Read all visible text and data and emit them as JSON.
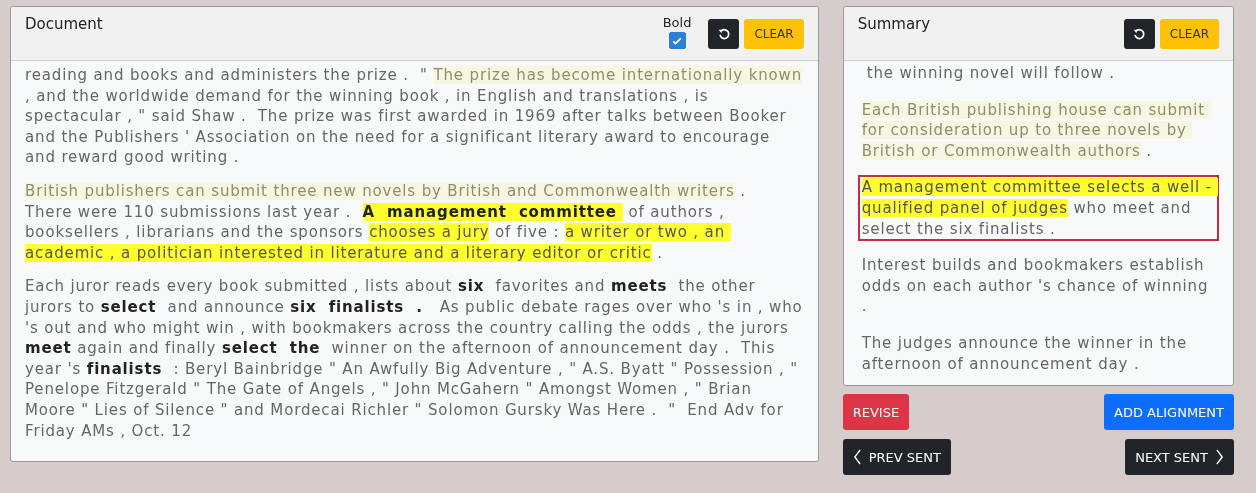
{
  "document": {
    "title": "Document",
    "bold_toggle": {
      "label": "Bold",
      "checked": true
    },
    "clear_label": "CLEAR",
    "paragraphs": [
      {
        "segments": [
          {
            "kind": "plain",
            "text": "reading and books and administers the prize .  \" "
          },
          {
            "kind": "faded",
            "text": "The prize has become internationally known"
          },
          {
            "kind": "plain",
            "text": " , and the worldwide demand for the winning book , in English and translations , is spectacular , \" said Shaw .  The prize was first awarded in 1969 after talks between Booker and the Publishers ' Association on the need for a significant literary award to encourage and reward good writing ."
          }
        ]
      },
      {
        "segments": [
          {
            "kind": "faded",
            "text": "British publishers can submit three new novels by British and Commonwealth writers"
          },
          {
            "kind": "plain",
            "text": " .  There were 110 submissions last year .  "
          },
          {
            "kind": "marked_bold",
            "text": "A  management  committee "
          },
          {
            "kind": "plain",
            "text": " of authors , booksellers , librarians and the sponsors "
          },
          {
            "kind": "marked",
            "text": "chooses a jury"
          },
          {
            "kind": "plain",
            "text": " of five : "
          },
          {
            "kind": "marked",
            "text": "a writer or two , an academic , a politician interested in literature and a literary editor or critic"
          },
          {
            "kind": "plain",
            "text": " ."
          }
        ]
      },
      {
        "segments": [
          {
            "kind": "plain",
            "text": "Each juror reads every book submitted , lists about "
          },
          {
            "kind": "bold",
            "text": "six"
          },
          {
            "kind": "plain",
            "text": "  favorites and "
          },
          {
            "kind": "bold",
            "text": "meets"
          },
          {
            "kind": "plain",
            "text": "  the other jurors to "
          },
          {
            "kind": "bold",
            "text": "select"
          },
          {
            "kind": "plain",
            "text": "  and announce "
          },
          {
            "kind": "bold",
            "text": "six  finalists  ."
          },
          {
            "kind": "plain",
            "text": "   As public debate rages over who 's in , who 's out and who might win , with bookmakers across the country calling the odds , the jurors "
          },
          {
            "kind": "bold",
            "text": "meet"
          },
          {
            "kind": "plain",
            "text": " again and finally "
          },
          {
            "kind": "bold",
            "text": "select  the"
          },
          {
            "kind": "plain",
            "text": "  winner on the afternoon of announcement day .  This year 's "
          },
          {
            "kind": "bold",
            "text": "finalists"
          },
          {
            "kind": "plain",
            "text": "  : Beryl Bainbridge \" An Awfully Big Adventure , \" A.S. Byatt \" Possession , \" Penelope Fitzgerald \" The Gate of Angels , \" John McGahern \" Amongst Women , \" Brian Moore \" Lies of Silence \" and Mordecai Richler \" Solomon Gursky Was Here .  \"  End Adv for Friday AMs , Oct. 12"
          }
        ]
      }
    ]
  },
  "summary": {
    "title": "Summary",
    "clear_label": "CLEAR",
    "sentences": [
      {
        "selected": false,
        "segments": [
          {
            "kind": "plain",
            "text": "the winning novel will follow ."
          }
        ]
      },
      {
        "selected": false,
        "segments": [
          {
            "kind": "faded",
            "text": "Each British publishing house can submit for consideration up to three novels by British or Commonwealth authors"
          },
          {
            "kind": "plain",
            "text": " ."
          }
        ]
      },
      {
        "selected": true,
        "segments": [
          {
            "kind": "marked",
            "text": "A management committee selects a well - qualified panel of judges"
          },
          {
            "kind": "plain",
            "text": " who meet and select the six finalists ."
          }
        ]
      },
      {
        "selected": false,
        "segments": [
          {
            "kind": "plain",
            "text": "Interest builds and bookmakers establish odds on each author 's chance of winning ."
          }
        ]
      },
      {
        "selected": false,
        "segments": [
          {
            "kind": "plain",
            "text": "The judges announce the winner in the afternoon of announcement day ."
          }
        ]
      }
    ]
  },
  "actions": {
    "revise": "REVISE",
    "add_alignment": "ADD ALIGNMENT",
    "prev": "PREV SENT",
    "next": "NEXT SENT"
  }
}
